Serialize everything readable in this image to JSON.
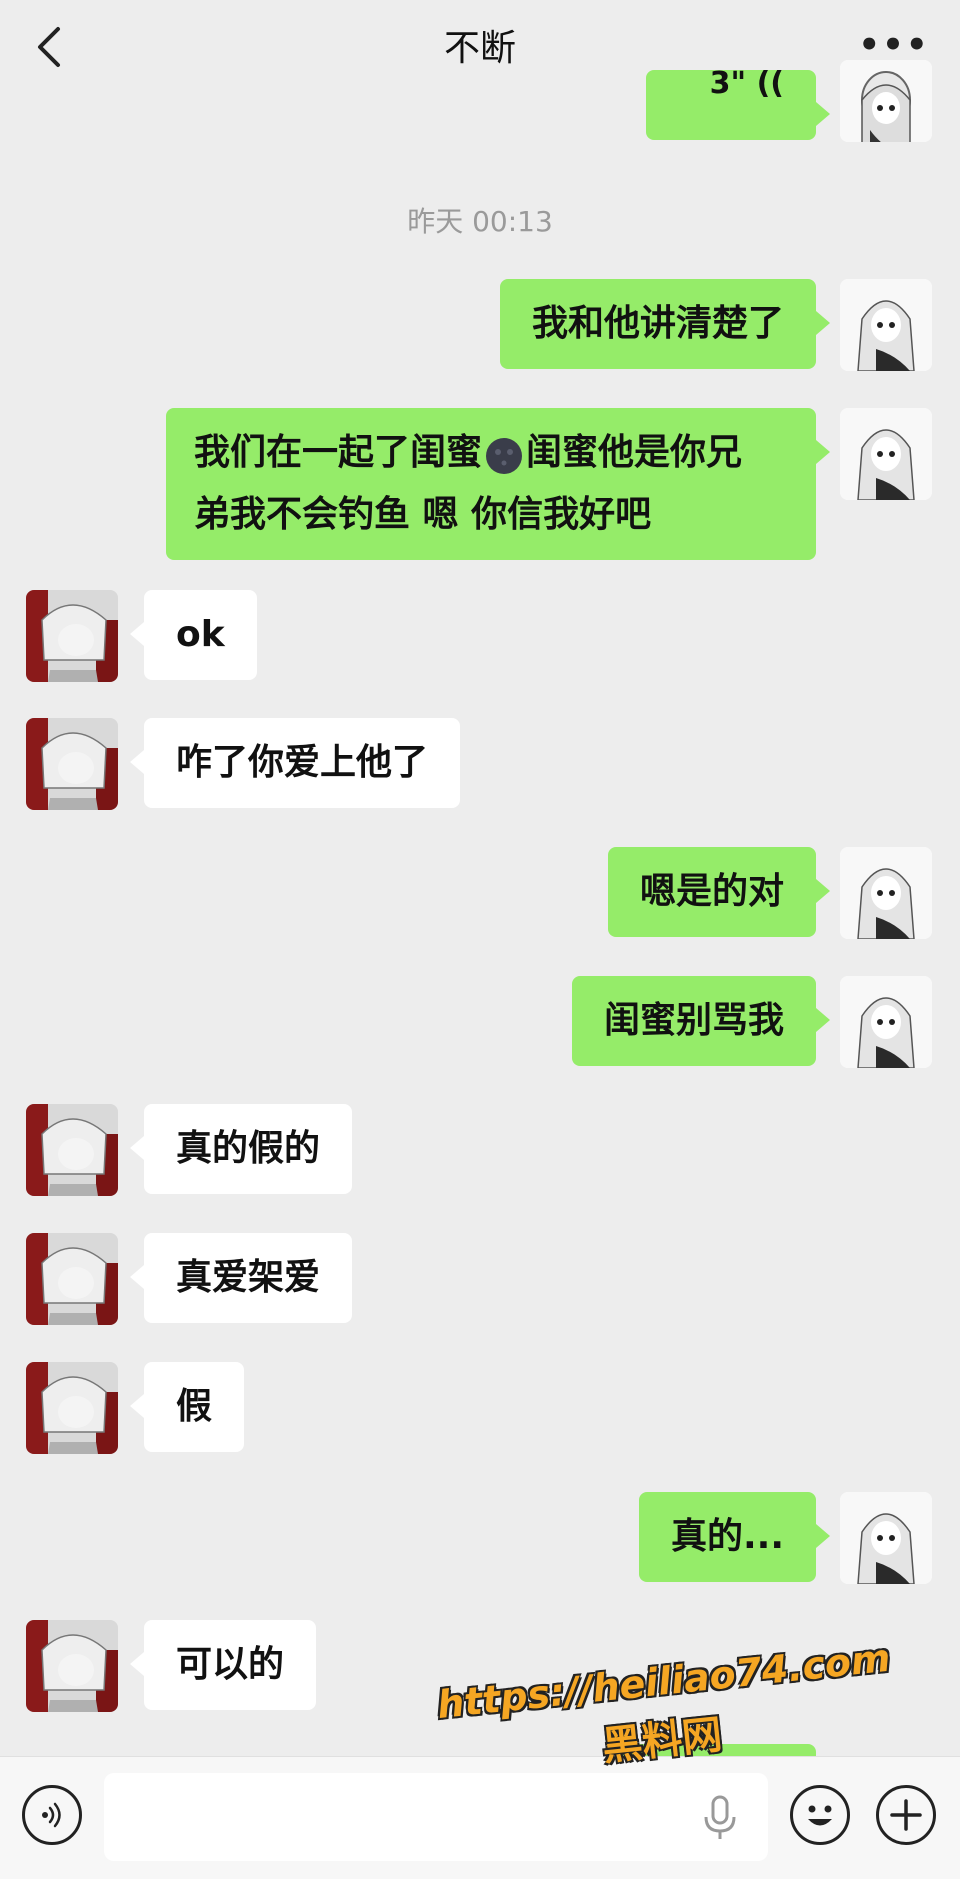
{
  "header": {
    "title": "不断",
    "back_icon": "chevron-left-icon",
    "more_label": "•••"
  },
  "timestamp": "昨天 00:13",
  "top_partial_bubble": "3\" ((",
  "messages": [
    {
      "from": "me",
      "text": "我和他讲清楚了"
    },
    {
      "from": "me",
      "text_line1": "我们在一起了闺蜜",
      "emoji": "new-moon-face-icon",
      "text_line1b": "闺蜜他是你兄",
      "text_line2": "弟我不会钓鱼 嗯 你信我好吧"
    },
    {
      "from": "them",
      "text": "ok"
    },
    {
      "from": "them",
      "text": "咋了你爱上他了"
    },
    {
      "from": "me",
      "text": "嗯是的对"
    },
    {
      "from": "me",
      "text": "闺蜜别骂我"
    },
    {
      "from": "them",
      "text": "真的假的"
    },
    {
      "from": "them",
      "text": "真爱架爱"
    },
    {
      "from": "them",
      "text": "假"
    },
    {
      "from": "me",
      "text": "真的..."
    },
    {
      "from": "them",
      "text": "可以的"
    }
  ],
  "watermark": {
    "url": "https://heiliao74.com",
    "name": "黑料网"
  },
  "colors": {
    "background": "#ededed",
    "my_bubble": "#95ec69",
    "their_bubble": "#ffffff",
    "watermark": "#f5a623"
  }
}
